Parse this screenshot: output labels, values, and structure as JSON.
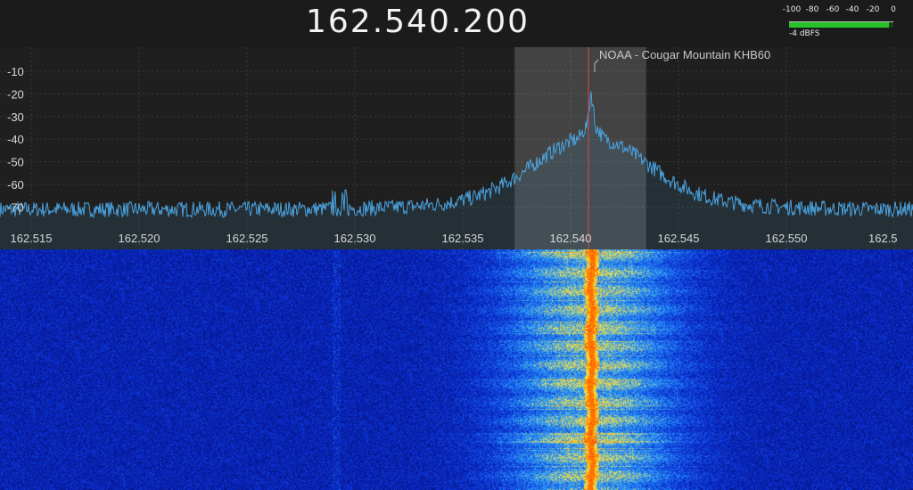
{
  "header": {
    "frequency": "162.540.200"
  },
  "level_meter": {
    "scale_labels": [
      "-100",
      "-80",
      "-60",
      "-40",
      "-20",
      "0"
    ],
    "level_dbfs": -4,
    "readout": "-4 dBFS",
    "fill_color": "#28c228"
  },
  "spectrum": {
    "marker_label": "NOAA - Cougar Mountain KHB60",
    "trace_color": "#4aa3e0",
    "passband_color": "#ffffff",
    "marker_color": "#e04a4a",
    "y_tick_labels": [
      "-10",
      "-20",
      "-30",
      "-40",
      "-50",
      "-60",
      "-70"
    ],
    "x_tick_labels": [
      "162.515",
      "162.520",
      "162.525",
      "162.530",
      "162.535",
      "162.540",
      "162.545",
      "162.550",
      "162.5"
    ],
    "center_frequency_mhz": 162.54,
    "passband_mhz": [
      162.5374,
      162.5435
    ]
  },
  "waterfall": {
    "palette": [
      "#030a57",
      "#0a2ad0",
      "#2aa0ff",
      "#ffe640",
      "#ffb000",
      "#ff4a00"
    ]
  }
}
